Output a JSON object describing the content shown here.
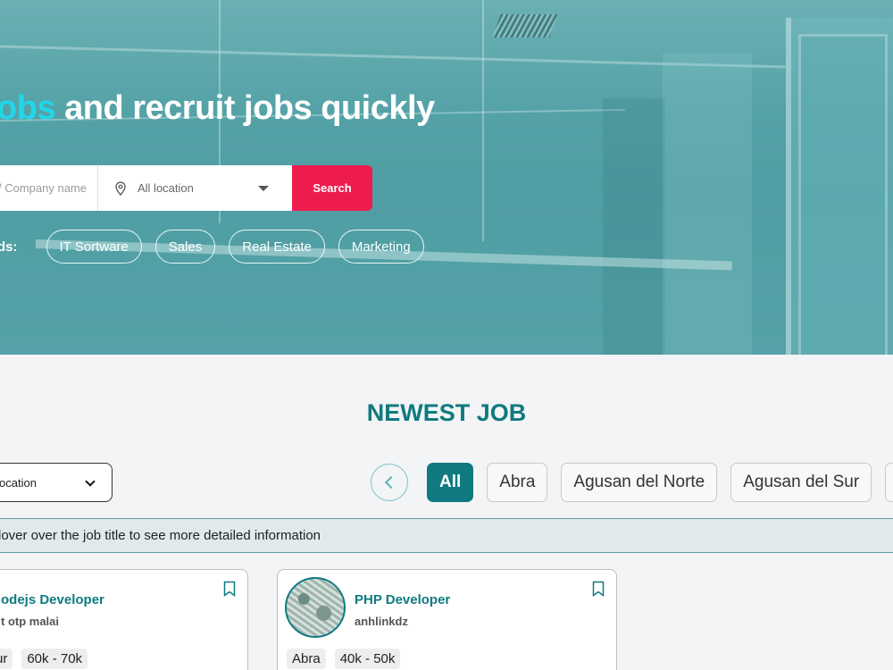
{
  "hero": {
    "headline_highlight": "obs",
    "headline_rest": " and recruit jobs quickly",
    "search": {
      "keyword_placeholder": "/ Company name",
      "location_value": "All location",
      "search_label": "Search"
    },
    "keywords": {
      "label": "ds:",
      "items": [
        "IT Sortware",
        "Sales",
        "Real Estate",
        "Marketing"
      ]
    }
  },
  "newest": {
    "title": "NEWEST JOB",
    "filter_select": "ocation",
    "location_tabs": [
      "All",
      "Abra",
      "Agusan del Norte",
      "Agusan del Sur"
    ],
    "hint": "lover over the job title to see more detailed information"
  },
  "jobs": [
    {
      "title": "odejs Developer",
      "company": "t otp malai",
      "location": "ur",
      "salary": "60k - 70k"
    },
    {
      "title": "PHP Developer",
      "company": "anhlinkdz",
      "location": "Abra",
      "salary": "40k - 50k"
    }
  ],
  "colors": {
    "brand": "#0f7a80",
    "accent": "#ee1c4e",
    "highlight": "#22d6ea"
  }
}
